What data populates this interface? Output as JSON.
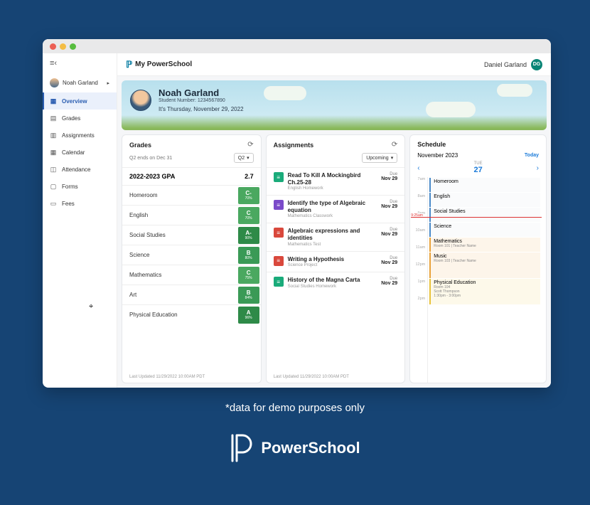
{
  "app_title": "My PowerSchool",
  "user": {
    "name": "Daniel Garland",
    "initials": "DG"
  },
  "banner": {
    "student_name": "Noah Garland",
    "student_number_label": "Student Number: 1234567890",
    "date_line": "It's Thursday, November 29, 2022"
  },
  "sidebar": {
    "student_name": "Noah Garland",
    "items": [
      {
        "label": "Overview",
        "icon": "▦"
      },
      {
        "label": "Grades",
        "icon": "▤"
      },
      {
        "label": "Assignments",
        "icon": "▥"
      },
      {
        "label": "Calendar",
        "icon": "▦"
      },
      {
        "label": "Attendance",
        "icon": "◫"
      },
      {
        "label": "Forms",
        "icon": "▢"
      },
      {
        "label": "Fees",
        "icon": "▭"
      }
    ]
  },
  "grades": {
    "title": "Grades",
    "term_note": "Q2 ends on Dec 31",
    "term_selected": "Q2",
    "gpa_label": "2022-2023 GPA",
    "gpa_value": "2.7",
    "rows": [
      {
        "subject": "Homeroom",
        "letter": "C-",
        "pct": "70%",
        "cls": "gc-C"
      },
      {
        "subject": "English",
        "letter": "C",
        "pct": "70%",
        "cls": "gc-C"
      },
      {
        "subject": "Social Studies",
        "letter": "A-",
        "pct": "90%",
        "cls": "gc-A"
      },
      {
        "subject": "Science",
        "letter": "B",
        "pct": "80%",
        "cls": "gc-B"
      },
      {
        "subject": "Mathematics",
        "letter": "C",
        "pct": "75%",
        "cls": "gc-C"
      },
      {
        "subject": "Art",
        "letter": "B",
        "pct": "84%",
        "cls": "gc-B"
      },
      {
        "subject": "Physical Education",
        "letter": "A",
        "pct": "96%",
        "cls": "gc-A"
      }
    ],
    "last_updated": "Last Updated 11/29/2022 10:00AM PDT"
  },
  "assignments": {
    "title": "Assignments",
    "filter": "Upcoming",
    "rows": [
      {
        "title": "Read To Kill A Mockingbird Ch.25-28",
        "meta": "English Homework",
        "due": "Nov 29",
        "cls": "ai-g",
        "icon": "≡"
      },
      {
        "title": "Identify the type of Algebraic equation",
        "meta": "Mathematics Classwork",
        "due": "Nov 29",
        "cls": "ai-p",
        "icon": "≡"
      },
      {
        "title": "Algebraic expressions and identities",
        "meta": "Mathematics Test",
        "due": "Nov 29",
        "cls": "ai-r",
        "icon": "≡"
      },
      {
        "title": "Writing a Hypothesis",
        "meta": "Science Project",
        "due": "Nov 29",
        "cls": "ai-r",
        "icon": "≡"
      },
      {
        "title": "History of the Magna Carta",
        "meta": "Social Studies Homework",
        "due": "Nov 29",
        "cls": "ai-g",
        "icon": "≡"
      }
    ],
    "due_label": "Due",
    "last_updated": "Last Updated 11/29/2022 10:00AM PDT"
  },
  "schedule": {
    "title": "Schedule",
    "month": "November 2023",
    "today_label": "Today",
    "dow": "TUE",
    "date": "27",
    "now_label": "9:25am",
    "hours": [
      "7am",
      "8am",
      "9am",
      "10am",
      "11am",
      "12pm",
      "1pm",
      "2pm"
    ],
    "events": [
      {
        "subject": "Homeroom",
        "sub": "",
        "cls": "blue h-1"
      },
      {
        "subject": "English",
        "sub": "",
        "cls": "blue h-1"
      },
      {
        "subject": "Social Studies",
        "sub": "",
        "cls": "blue h-1"
      },
      {
        "subject": "Science",
        "sub": "",
        "cls": "blue h-1"
      },
      {
        "subject": "Mathematics",
        "sub": "Room 101 | Teacher Name",
        "cls": "orange h-1"
      },
      {
        "subject": "Music",
        "sub": "Room 103 | Teacher Name",
        "cls": "orange h-2"
      },
      {
        "subject": "Physical Education",
        "sub": "Room 104\nScott Thompson\n1:30pm - 3:00pm",
        "cls": "yellow h-2"
      }
    ]
  },
  "demo_note": "*data for demo purposes only",
  "brand": "PowerSchool"
}
